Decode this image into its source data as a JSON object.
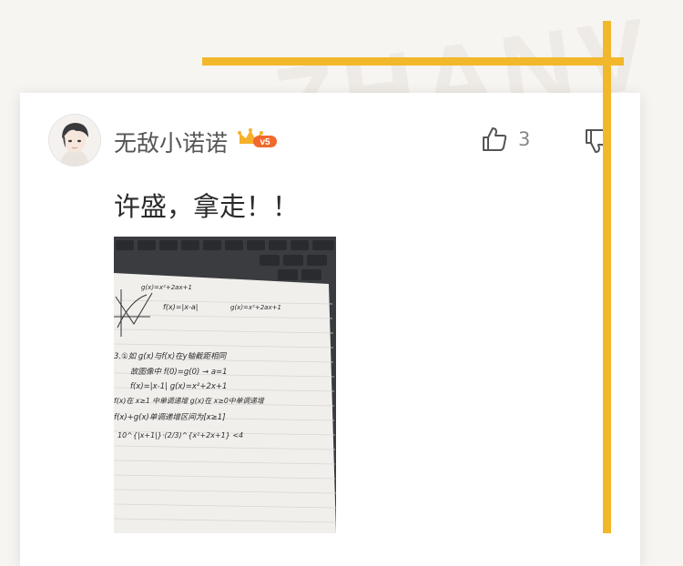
{
  "background": {
    "watermark": "ZHANV"
  },
  "comment": {
    "username": "无敌小诺诺",
    "vip_badge": "v5",
    "like_count": "3",
    "text": "许盛，拿走！！",
    "icons": {
      "avatar": "avatar-image",
      "crown": "crown-icon",
      "like": "thumbs-up-icon",
      "dislike": "thumbs-down-icon"
    }
  },
  "photo": {
    "lines": [
      "g(x)=x²+2ax+1",
      "f(x)=|x-a|",
      "g(x)=x²+2ax+1",
      "3.①如  g(x)与f(x)在y轴截距相同",
      "故图像中  f(0)=g(0)  → a=1",
      "f(x)=|x-1|   g(x)=x²+2x+1",
      "f(x)在 x≥1 中单调递增   g(x)在 x≥0中单调递增",
      "f(x)+g(x)单调递增区间为[x≥1]",
      "10^{|x+1|}·(2/3)^{x²+2x+1} <4"
    ]
  },
  "colors": {
    "accent": "#f2b82b",
    "card": "#ffffff",
    "username": "#555555",
    "text": "#2b2b2b",
    "muted": "#888888"
  }
}
